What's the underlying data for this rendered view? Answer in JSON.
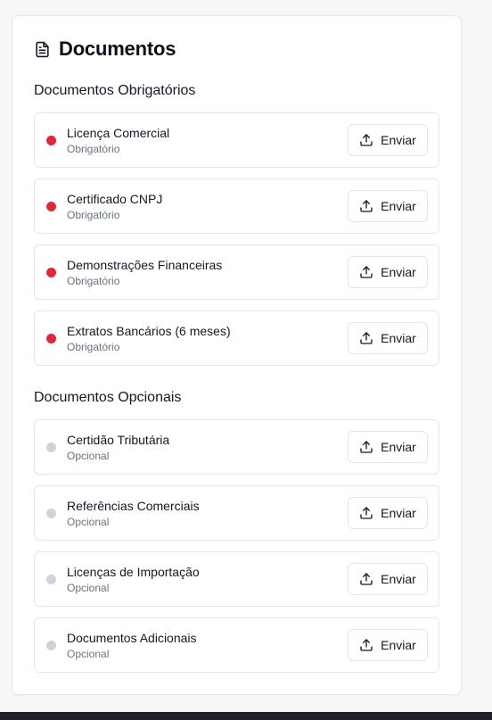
{
  "card": {
    "title": "Documentos",
    "title_icon": "file-text-icon"
  },
  "required_section": {
    "title": "Documentos Obrigatórios",
    "items": [
      {
        "name": "Licença Comercial",
        "status": "Obrigatório",
        "button": "Enviar"
      },
      {
        "name": "Certificado CNPJ",
        "status": "Obrigatório",
        "button": "Enviar"
      },
      {
        "name": "Demonstrações Financeiras",
        "status": "Obrigatório",
        "button": "Enviar"
      },
      {
        "name": "Extratos Bancários (6 meses)",
        "status": "Obrigatório",
        "button": "Enviar"
      }
    ]
  },
  "optional_section": {
    "title": "Documentos Opcionais",
    "items": [
      {
        "name": "Certidão Tributária",
        "status": "Opcional",
        "button": "Enviar"
      },
      {
        "name": "Referências Comerciais",
        "status": "Opcional",
        "button": "Enviar"
      },
      {
        "name": "Licenças de Importação",
        "status": "Opcional",
        "button": "Enviar"
      },
      {
        "name": "Documentos Adicionais",
        "status": "Opcional",
        "button": "Enviar"
      }
    ]
  },
  "colors": {
    "required_dot": "#dc2a3c",
    "optional_dot": "#cfd3da"
  },
  "icons": {
    "upload": "upload-icon"
  }
}
